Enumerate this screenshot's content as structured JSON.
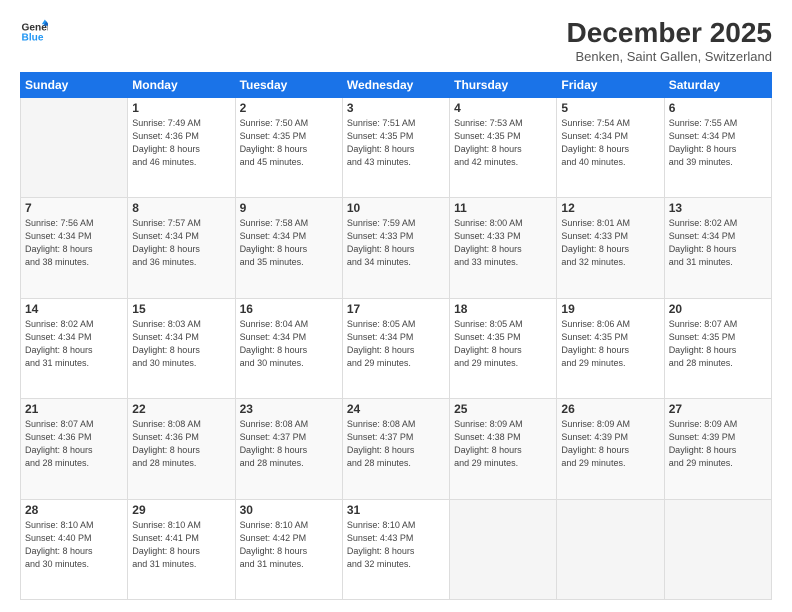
{
  "logo": {
    "line1": "General",
    "line2": "Blue"
  },
  "title": "December 2025",
  "subtitle": "Benken, Saint Gallen, Switzerland",
  "days_of_week": [
    "Sunday",
    "Monday",
    "Tuesday",
    "Wednesday",
    "Thursday",
    "Friday",
    "Saturday"
  ],
  "weeks": [
    [
      {
        "day": "",
        "info": ""
      },
      {
        "day": "1",
        "info": "Sunrise: 7:49 AM\nSunset: 4:36 PM\nDaylight: 8 hours\nand 46 minutes."
      },
      {
        "day": "2",
        "info": "Sunrise: 7:50 AM\nSunset: 4:35 PM\nDaylight: 8 hours\nand 45 minutes."
      },
      {
        "day": "3",
        "info": "Sunrise: 7:51 AM\nSunset: 4:35 PM\nDaylight: 8 hours\nand 43 minutes."
      },
      {
        "day": "4",
        "info": "Sunrise: 7:53 AM\nSunset: 4:35 PM\nDaylight: 8 hours\nand 42 minutes."
      },
      {
        "day": "5",
        "info": "Sunrise: 7:54 AM\nSunset: 4:34 PM\nDaylight: 8 hours\nand 40 minutes."
      },
      {
        "day": "6",
        "info": "Sunrise: 7:55 AM\nSunset: 4:34 PM\nDaylight: 8 hours\nand 39 minutes."
      }
    ],
    [
      {
        "day": "7",
        "info": "Sunrise: 7:56 AM\nSunset: 4:34 PM\nDaylight: 8 hours\nand 38 minutes."
      },
      {
        "day": "8",
        "info": "Sunrise: 7:57 AM\nSunset: 4:34 PM\nDaylight: 8 hours\nand 36 minutes."
      },
      {
        "day": "9",
        "info": "Sunrise: 7:58 AM\nSunset: 4:34 PM\nDaylight: 8 hours\nand 35 minutes."
      },
      {
        "day": "10",
        "info": "Sunrise: 7:59 AM\nSunset: 4:33 PM\nDaylight: 8 hours\nand 34 minutes."
      },
      {
        "day": "11",
        "info": "Sunrise: 8:00 AM\nSunset: 4:33 PM\nDaylight: 8 hours\nand 33 minutes."
      },
      {
        "day": "12",
        "info": "Sunrise: 8:01 AM\nSunset: 4:33 PM\nDaylight: 8 hours\nand 32 minutes."
      },
      {
        "day": "13",
        "info": "Sunrise: 8:02 AM\nSunset: 4:34 PM\nDaylight: 8 hours\nand 31 minutes."
      }
    ],
    [
      {
        "day": "14",
        "info": "Sunrise: 8:02 AM\nSunset: 4:34 PM\nDaylight: 8 hours\nand 31 minutes."
      },
      {
        "day": "15",
        "info": "Sunrise: 8:03 AM\nSunset: 4:34 PM\nDaylight: 8 hours\nand 30 minutes."
      },
      {
        "day": "16",
        "info": "Sunrise: 8:04 AM\nSunset: 4:34 PM\nDaylight: 8 hours\nand 30 minutes."
      },
      {
        "day": "17",
        "info": "Sunrise: 8:05 AM\nSunset: 4:34 PM\nDaylight: 8 hours\nand 29 minutes."
      },
      {
        "day": "18",
        "info": "Sunrise: 8:05 AM\nSunset: 4:35 PM\nDaylight: 8 hours\nand 29 minutes."
      },
      {
        "day": "19",
        "info": "Sunrise: 8:06 AM\nSunset: 4:35 PM\nDaylight: 8 hours\nand 29 minutes."
      },
      {
        "day": "20",
        "info": "Sunrise: 8:07 AM\nSunset: 4:35 PM\nDaylight: 8 hours\nand 28 minutes."
      }
    ],
    [
      {
        "day": "21",
        "info": "Sunrise: 8:07 AM\nSunset: 4:36 PM\nDaylight: 8 hours\nand 28 minutes."
      },
      {
        "day": "22",
        "info": "Sunrise: 8:08 AM\nSunset: 4:36 PM\nDaylight: 8 hours\nand 28 minutes."
      },
      {
        "day": "23",
        "info": "Sunrise: 8:08 AM\nSunset: 4:37 PM\nDaylight: 8 hours\nand 28 minutes."
      },
      {
        "day": "24",
        "info": "Sunrise: 8:08 AM\nSunset: 4:37 PM\nDaylight: 8 hours\nand 28 minutes."
      },
      {
        "day": "25",
        "info": "Sunrise: 8:09 AM\nSunset: 4:38 PM\nDaylight: 8 hours\nand 29 minutes."
      },
      {
        "day": "26",
        "info": "Sunrise: 8:09 AM\nSunset: 4:39 PM\nDaylight: 8 hours\nand 29 minutes."
      },
      {
        "day": "27",
        "info": "Sunrise: 8:09 AM\nSunset: 4:39 PM\nDaylight: 8 hours\nand 29 minutes."
      }
    ],
    [
      {
        "day": "28",
        "info": "Sunrise: 8:10 AM\nSunset: 4:40 PM\nDaylight: 8 hours\nand 30 minutes."
      },
      {
        "day": "29",
        "info": "Sunrise: 8:10 AM\nSunset: 4:41 PM\nDaylight: 8 hours\nand 31 minutes."
      },
      {
        "day": "30",
        "info": "Sunrise: 8:10 AM\nSunset: 4:42 PM\nDaylight: 8 hours\nand 31 minutes."
      },
      {
        "day": "31",
        "info": "Sunrise: 8:10 AM\nSunset: 4:43 PM\nDaylight: 8 hours\nand 32 minutes."
      },
      {
        "day": "",
        "info": ""
      },
      {
        "day": "",
        "info": ""
      },
      {
        "day": "",
        "info": ""
      }
    ]
  ]
}
